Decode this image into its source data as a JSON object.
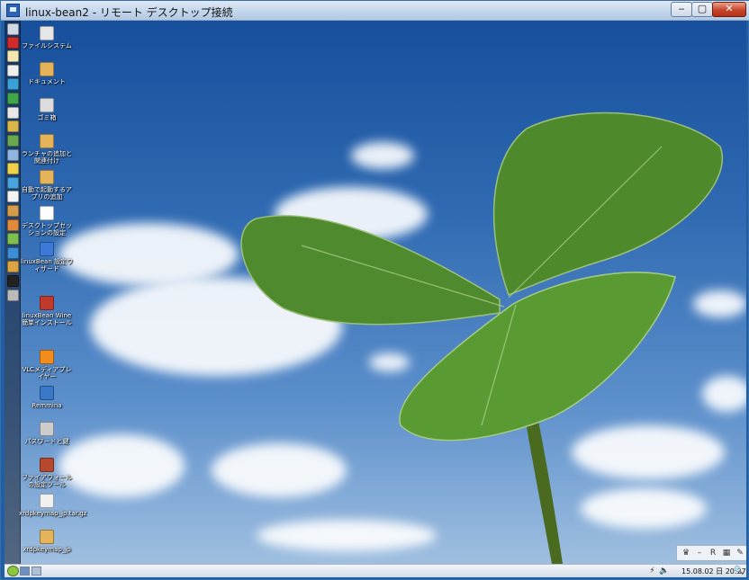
{
  "window": {
    "title": "linux-bean2 - リモート デスクトップ接続",
    "minimize_label": "‒",
    "maximize_label": "▢",
    "close_label": "✕"
  },
  "desktop_icons": [
    {
      "label": "ファイルシステム",
      "icon": "filesystem-icon",
      "color": "#e6e6e6"
    },
    {
      "label": "ドキュメント",
      "icon": "documents-folder-icon",
      "color": "#e5b45a"
    },
    {
      "label": "ゴミ箱",
      "icon": "trash-icon",
      "color": "#dcdcdc"
    },
    {
      "label": "ランチャの追加と関連付け",
      "icon": "launcher-folder-icon",
      "color": "#e5b45a"
    },
    {
      "label": "自動で起動するアプリの追加",
      "icon": "autostart-folder-icon",
      "color": "#e5b45a"
    },
    {
      "label": "デスクトップセッションの設定",
      "icon": "session-settings-icon",
      "color": "#ffffff"
    },
    {
      "label": "linuxBean 設定ウィザード",
      "icon": "settings-wizard-icon",
      "color": "#3b7ad6"
    },
    {
      "label": "linuxBean Wine 簡単インストール",
      "icon": "wine-installer-icon",
      "color": "#c0392b"
    },
    {
      "label": "VLCメディアプレイヤー",
      "icon": "vlc-icon",
      "color": "#f28c1c"
    },
    {
      "label": "Remmina",
      "icon": "remmina-icon",
      "color": "#3a78c8"
    },
    {
      "label": "パスワードと鍵",
      "icon": "passwords-keys-icon",
      "color": "#cccccc"
    },
    {
      "label": "ファイアウォールの設定ツール",
      "icon": "firewall-icon",
      "color": "#b5482d"
    },
    {
      "label": "xrdpkeymap_jp.tar.gz",
      "icon": "archive-file-icon",
      "color": "#f0f0f0"
    },
    {
      "label": "xrdpkeymap_jp",
      "icon": "folder-icon",
      "color": "#e5b45a"
    }
  ],
  "launcher_icons": [
    {
      "name": "filemanager-icon",
      "color": "#cfd8e3"
    },
    {
      "name": "opera-icon",
      "color": "#d22b2b"
    },
    {
      "name": "notes-icon",
      "color": "#f4e7b0"
    },
    {
      "name": "editor-icon",
      "color": "#eeeeee"
    },
    {
      "name": "network-icon",
      "color": "#3aa0d8"
    },
    {
      "name": "green-app-icon",
      "color": "#3fa64a"
    },
    {
      "name": "disc-icon",
      "color": "#e8e8e8"
    },
    {
      "name": "photo-icon",
      "color": "#d9b54a"
    },
    {
      "name": "image-viewer-icon",
      "color": "#6aa84f"
    },
    {
      "name": "screenshot-icon",
      "color": "#8fb5e0"
    },
    {
      "name": "arrow-tool-icon",
      "color": "#f0d24a"
    },
    {
      "name": "blue-app-icon",
      "color": "#4aa3df"
    },
    {
      "name": "gear-icon",
      "color": "#f2f2f2"
    },
    {
      "name": "package-icon",
      "color": "#d49b4a"
    },
    {
      "name": "flower-icon",
      "color": "#e08a3a"
    },
    {
      "name": "chart-icon",
      "color": "#7fbf4d"
    },
    {
      "name": "globe-icon",
      "color": "#3c8fd6"
    },
    {
      "name": "media-icon",
      "color": "#d9a441"
    },
    {
      "name": "terminal-icon",
      "color": "#222222"
    },
    {
      "name": "shutdown-icon",
      "color": "#bbbbbb"
    }
  ],
  "tray_box": [
    {
      "name": "crown-icon",
      "glyph": "♛"
    },
    {
      "name": "minus-icon",
      "glyph": "–"
    },
    {
      "name": "r-icon",
      "glyph": "R"
    },
    {
      "name": "grid-icon",
      "glyph": "▦"
    },
    {
      "name": "pen-icon",
      "glyph": "✎"
    }
  ],
  "panel": {
    "clock": "15.08.02 日 20:27",
    "network_glyph": "⚡",
    "volume_glyph": "🔈",
    "search_glyph": "🔍"
  }
}
